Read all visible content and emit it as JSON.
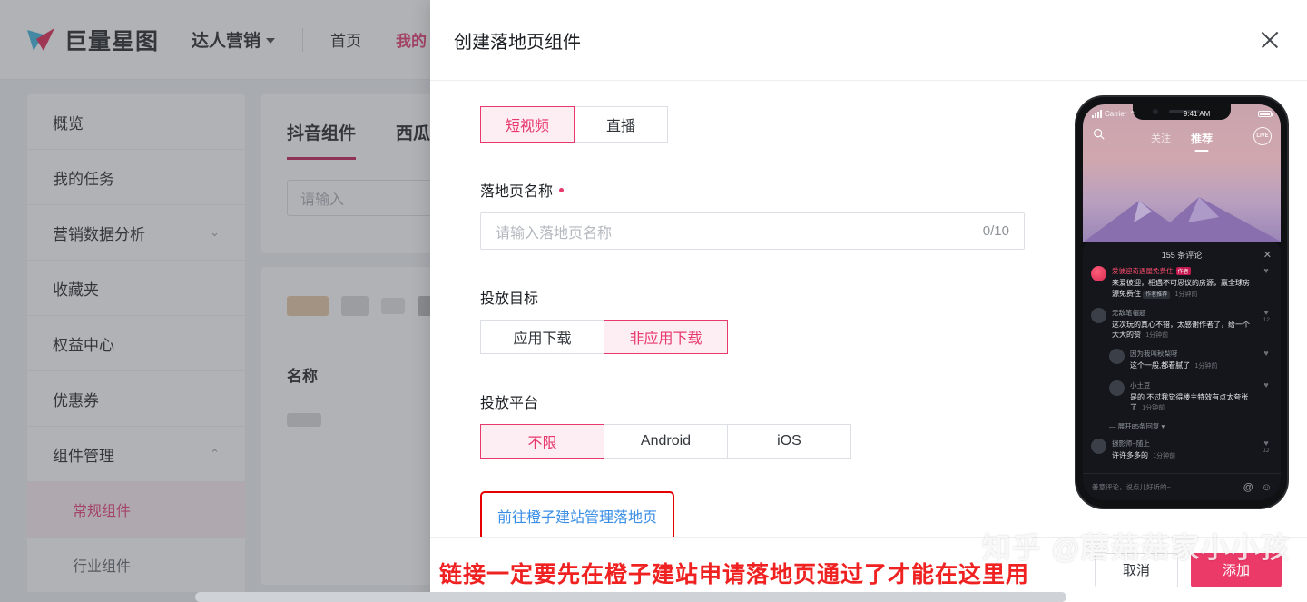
{
  "topbar": {
    "brand": "巨量星图",
    "primary_nav": "达人营销",
    "links": [
      {
        "label": "首页",
        "active": false
      },
      {
        "label": "我的",
        "active": true
      }
    ]
  },
  "sidebar": {
    "items": [
      {
        "label": "概览",
        "expandable": false
      },
      {
        "label": "我的任务",
        "expandable": false
      },
      {
        "label": "营销数据分析",
        "expandable": true,
        "chevron": "chevron-down"
      },
      {
        "label": "收藏夹",
        "expandable": false
      },
      {
        "label": "权益中心",
        "expandable": false
      },
      {
        "label": "优惠券",
        "expandable": false
      },
      {
        "label": "组件管理",
        "expandable": true,
        "chevron": "chevron-up"
      }
    ],
    "subitems": [
      {
        "label": "常规组件",
        "active": true
      },
      {
        "label": "行业组件",
        "active": false
      }
    ]
  },
  "content": {
    "tabs": [
      {
        "label": "抖音组件",
        "active": true
      },
      {
        "label": "西瓜组件",
        "active": false
      }
    ],
    "search_placeholder": "请输入",
    "table_header": "名称"
  },
  "modal": {
    "title": "创建落地页组件",
    "close_icon": "close-icon",
    "type_tabs": [
      {
        "label": "短视频",
        "selected": true
      },
      {
        "label": "直播",
        "selected": false
      }
    ],
    "name_field": {
      "label": "落地页名称",
      "required": true,
      "placeholder": "请输入落地页名称",
      "counter": "0/10"
    },
    "goal_field": {
      "label": "投放目标",
      "options": [
        {
          "label": "应用下载",
          "selected": false
        },
        {
          "label": "非应用下载",
          "selected": true
        }
      ]
    },
    "platform_field": {
      "label": "投放平台",
      "options": [
        {
          "label": "不限",
          "selected": true
        },
        {
          "label": "Android",
          "selected": false
        },
        {
          "label": "iOS",
          "selected": false
        }
      ]
    },
    "link_text": "前往橙子建站管理落地页",
    "footer": {
      "cancel": "取消",
      "confirm": "添加"
    }
  },
  "phone_preview": {
    "status_bar": {
      "carrier": "Carrier",
      "time": "9:41 AM"
    },
    "feed_tabs": [
      {
        "label": "关注",
        "active": false
      },
      {
        "label": "推荐",
        "active": true
      }
    ],
    "live_badge": "LIVE",
    "comments_header": "155 条评论",
    "comments": [
      {
        "user": "爱彼迎奇遇屋免费住",
        "badge": "作者",
        "text": "来爱彼迎，相遇不可思议的房源，赢全球房源免费住",
        "chip": "作者推荐",
        "time": "1分钟前",
        "likes": "",
        "reply": false
      },
      {
        "user": "无敌笔帽题",
        "badge": "",
        "text": "这次玩的真心不错，太感谢作者了，给一个大大的赞",
        "chip": "",
        "time": "1分钟前",
        "likes": "12",
        "reply": false
      },
      {
        "user": "因为我叫秋梨呀",
        "badge": "",
        "text": "这个一般,都看腻了",
        "chip": "",
        "time": "1分钟前",
        "likes": "",
        "reply": true
      },
      {
        "user": "小土豆",
        "badge": "",
        "text": "是的 不过我觉得楼主特效有点太夸张了",
        "chip": "",
        "time": "1分钟前",
        "likes": "",
        "reply": true
      },
      {
        "user": "摄影师~随上",
        "badge": "",
        "text": "许许多多的",
        "chip": "",
        "time": "1分钟前",
        "likes": "12",
        "reply": false
      }
    ],
    "expand_replies": "展开85条回复",
    "input_placeholder": "善意评论，说点儿好听的~",
    "input_icons": [
      "at-icon",
      "emoji-icon"
    ]
  },
  "annotation": "链接一定要先在橙子建站申请落地页通过了才能在这里用",
  "watermark": "知乎 @蘑菇菇家小小孩",
  "colors": {
    "accent_pink": "#e8386d",
    "primary_button": "#eb3a68",
    "link_blue": "#3a8ee6",
    "annotation_red": "#ef2121"
  }
}
